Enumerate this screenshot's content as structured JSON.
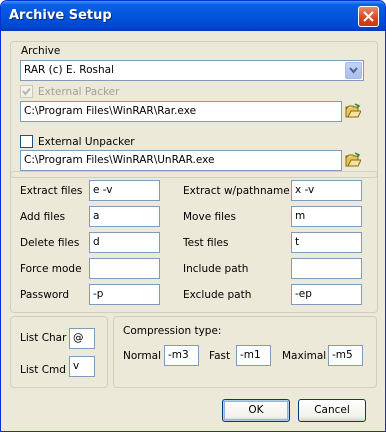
{
  "window": {
    "title": "Archive Setup"
  },
  "archive": {
    "group_label": "Archive",
    "selected": "RAR (c) E. Roshal",
    "external_packer_label": "External Packer",
    "external_packer_checked": true,
    "external_packer_path": "C:\\Program Files\\WinRAR\\Rar.exe",
    "external_unpacker_label": "External Unpacker",
    "external_unpacker_checked": false,
    "external_unpacker_path": "C:\\Program Files\\WinRAR\\UnRAR.exe"
  },
  "commands": {
    "left": [
      {
        "label": "Extract files",
        "value": "e -v"
      },
      {
        "label": "Add files",
        "value": "a"
      },
      {
        "label": "Delete files",
        "value": "d"
      },
      {
        "label": "Force mode",
        "value": ""
      },
      {
        "label": "Password",
        "value": "-p"
      }
    ],
    "right": [
      {
        "label": "Extract w/pathname",
        "value": "x -v"
      },
      {
        "label": "Move files",
        "value": "m"
      },
      {
        "label": "Test files",
        "value": "t"
      },
      {
        "label": "Include path",
        "value": ""
      },
      {
        "label": "Exclude path",
        "value": "-ep"
      }
    ]
  },
  "list": {
    "char_label": "List Char",
    "char_value": "@",
    "cmd_label": "List Cmd",
    "cmd_value": "v"
  },
  "compression": {
    "title": "Compression type:",
    "normal_label": "Normal",
    "normal_value": "-m3",
    "fast_label": "Fast",
    "fast_value": "-m1",
    "maximal_label": "Maximal",
    "maximal_value": "-m5"
  },
  "buttons": {
    "ok": "OK",
    "cancel": "Cancel"
  },
  "colors": {
    "titlebar": "#0255dd",
    "dialog_bg": "#ece9d8",
    "field_border": "#7f9db9"
  }
}
